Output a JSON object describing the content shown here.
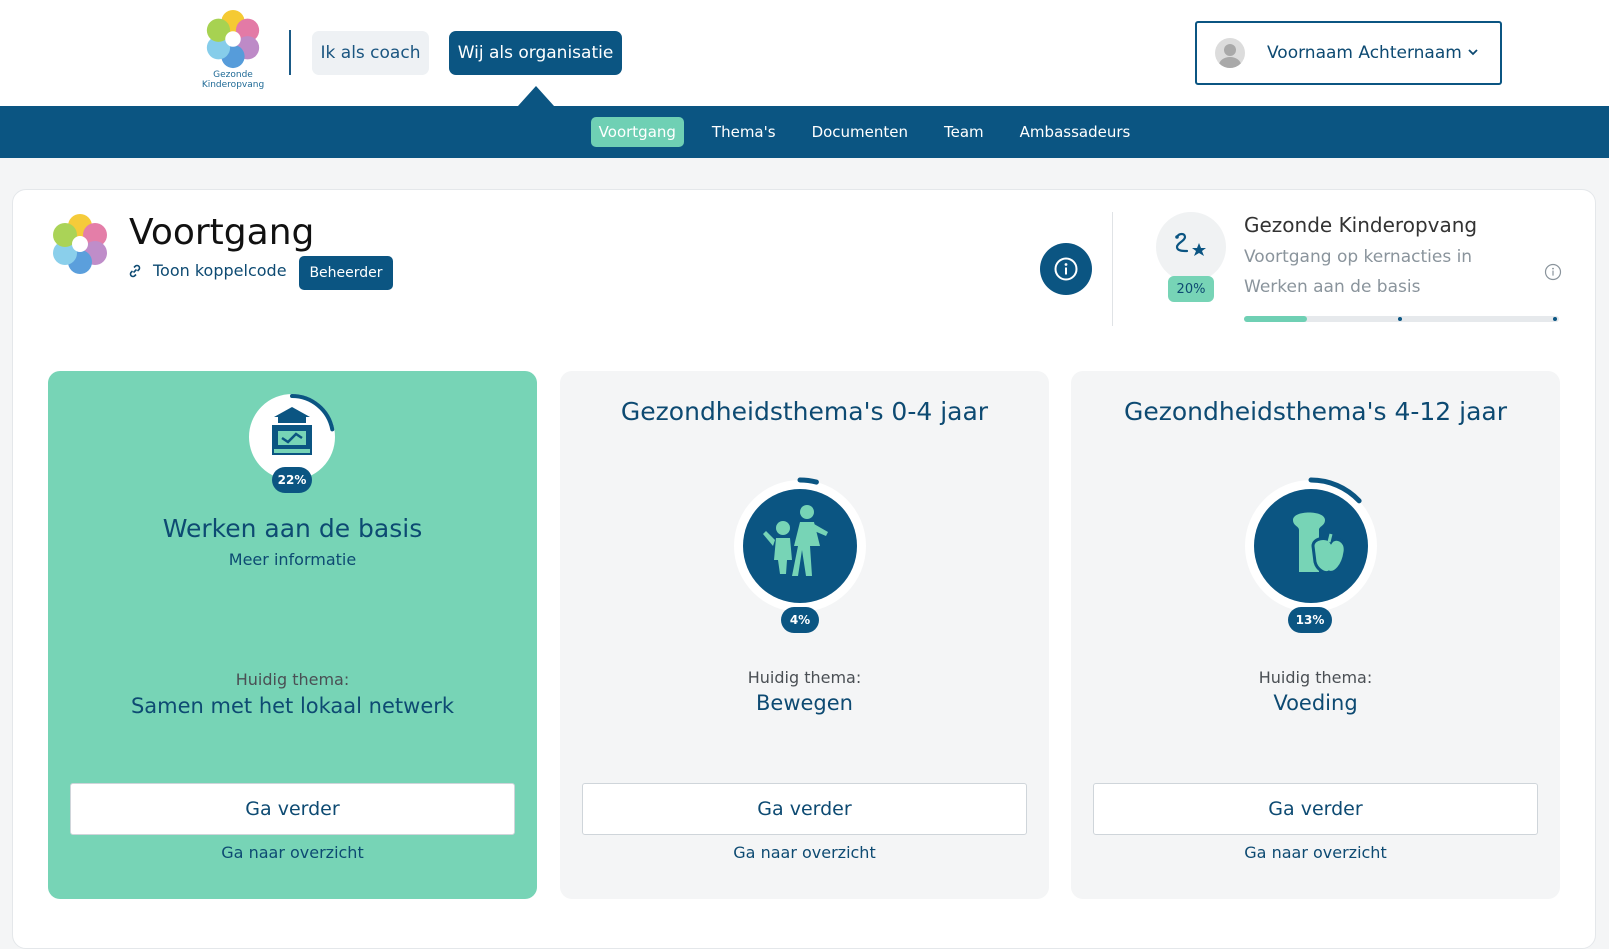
{
  "brand": {
    "name_line1": "Gezonde",
    "name_line2": "Kinderopvang"
  },
  "header": {
    "role_coach": "Ik als coach",
    "role_org": "Wij als organisatie",
    "user_name": "Voornaam Achternaam"
  },
  "nav": [
    {
      "label": "Voortgang",
      "active": true
    },
    {
      "label": "Thema's",
      "active": false
    },
    {
      "label": "Documenten",
      "active": false
    },
    {
      "label": "Team",
      "active": false
    },
    {
      "label": "Ambassadeurs",
      "active": false
    }
  ],
  "page": {
    "title": "Voortgang",
    "link_label": "Toon koppelcode",
    "role_badge": "Beheerder"
  },
  "summary": {
    "title": "Gezonde Kinderopvang",
    "subtitle": "Voortgang op kernacties in Werken aan de basis",
    "percent_label": "20%",
    "progress": 0.2
  },
  "cards": [
    {
      "title": "Werken aan de basis",
      "more": "Meer informatie",
      "percent_label": "22%",
      "progress": 0.22,
      "current_label": "Huidig thema:",
      "current_value": "Samen met het lokaal netwerk",
      "button": "Ga verder",
      "overview": "Ga naar overzicht"
    },
    {
      "heading": "Gezondheidsthema's 0-4 jaar",
      "percent_label": "4%",
      "progress": 0.04,
      "current_label": "Huidig thema:",
      "current_value": "Bewegen",
      "button": "Ga verder",
      "overview": "Ga naar overzicht"
    },
    {
      "heading": "Gezondheidsthema's 4-12 jaar",
      "percent_label": "13%",
      "progress": 0.13,
      "current_label": "Huidig thema:",
      "current_value": "Voeding",
      "button": "Ga verder",
      "overview": "Ga naar overzicht"
    }
  ],
  "colors": {
    "primary": "#0b5582",
    "accent": "#77d4b6",
    "card_bg": "#f4f5f6"
  }
}
